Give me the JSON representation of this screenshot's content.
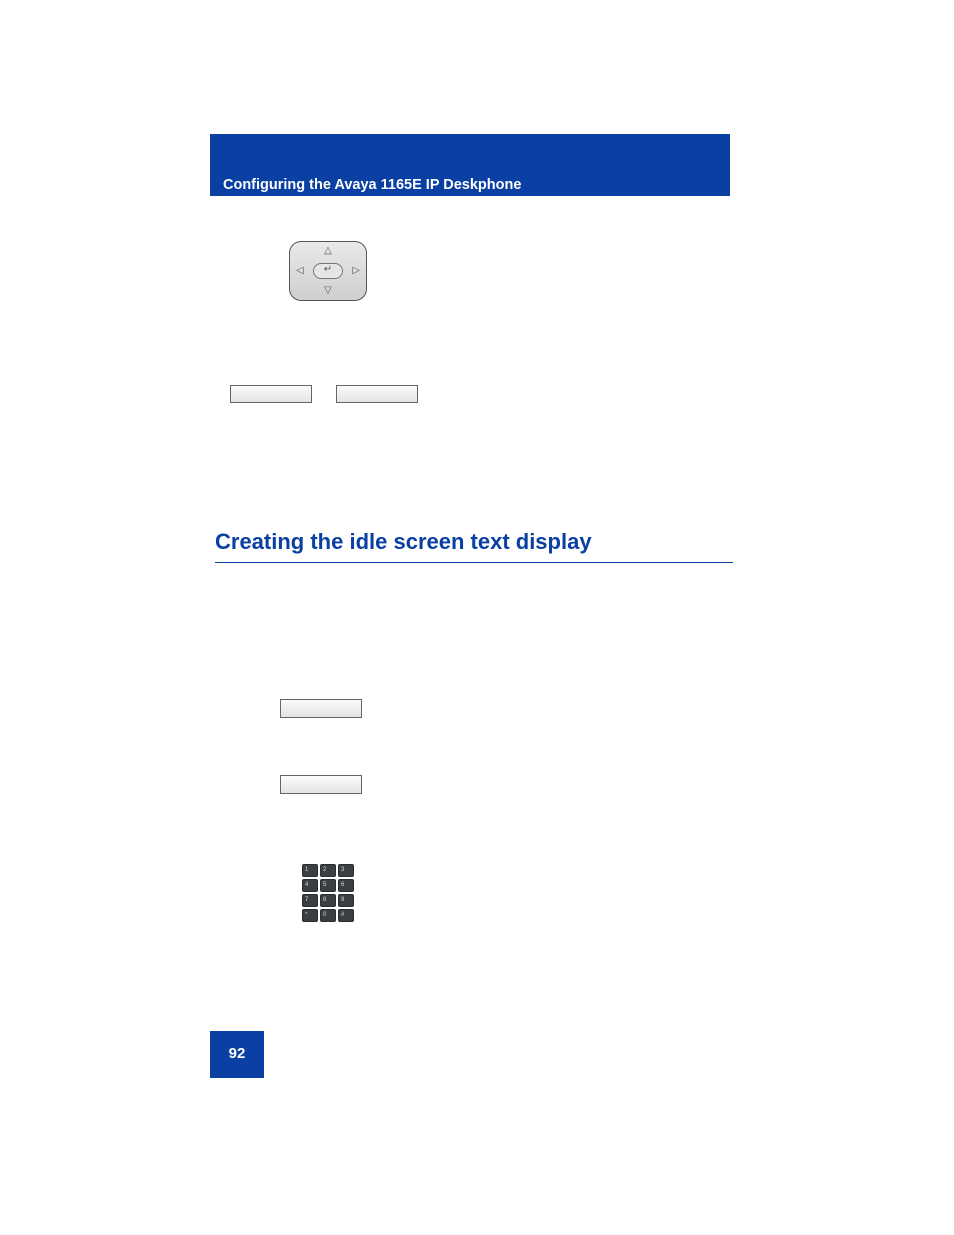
{
  "header": {
    "title": "Configuring the Avaya 1165E IP Deskphone"
  },
  "section": {
    "heading": "Creating the idle screen text display"
  },
  "dialpad": {
    "rows": [
      [
        "1",
        "2",
        "3"
      ],
      [
        "4",
        "5",
        "6"
      ],
      [
        "7",
        "8",
        "9"
      ],
      [
        "*",
        "0",
        "#"
      ]
    ]
  },
  "page_number": "92"
}
